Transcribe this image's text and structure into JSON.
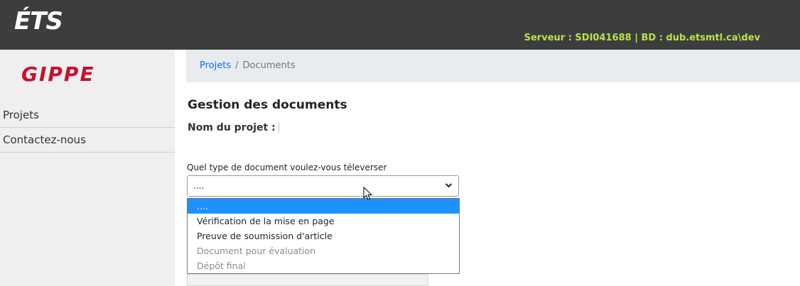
{
  "header": {
    "logo_text": "ÉTS",
    "server_info": "Serveur : SDI041688 | BD : dub.etsmtl.ca\\dev"
  },
  "sidebar": {
    "logo_text": "GIPPE",
    "items": [
      {
        "label": "Projets"
      },
      {
        "label": "Contactez-nous"
      }
    ]
  },
  "breadcrumb": {
    "link": "Projets",
    "separator": "/",
    "current": "Documents"
  },
  "main": {
    "title": "Gestion des documents",
    "project_label": "Nom du projet :",
    "question": "Quel type de document voulez-vous téleverser",
    "select": {
      "value": "....",
      "options": [
        {
          "label": "....",
          "selected": true,
          "disabled": false
        },
        {
          "label": "Vérification de la mise en page",
          "selected": false,
          "disabled": false
        },
        {
          "label": "Preuve de soumission d'article",
          "selected": false,
          "disabled": false
        },
        {
          "label": "Document pour évaluation",
          "selected": false,
          "disabled": true
        },
        {
          "label": "Dépôt final",
          "selected": false,
          "disabled": true
        }
      ]
    }
  },
  "icons": {
    "chevron": "chevron-down-icon",
    "cursor": "mouse-pointer-icon"
  },
  "colors": {
    "topbar": "#3d3d3d",
    "server_text": "#b7e34a",
    "gippe_logo": "#c8102e",
    "link": "#0d6efd",
    "selected_option": "#1e90ff"
  }
}
